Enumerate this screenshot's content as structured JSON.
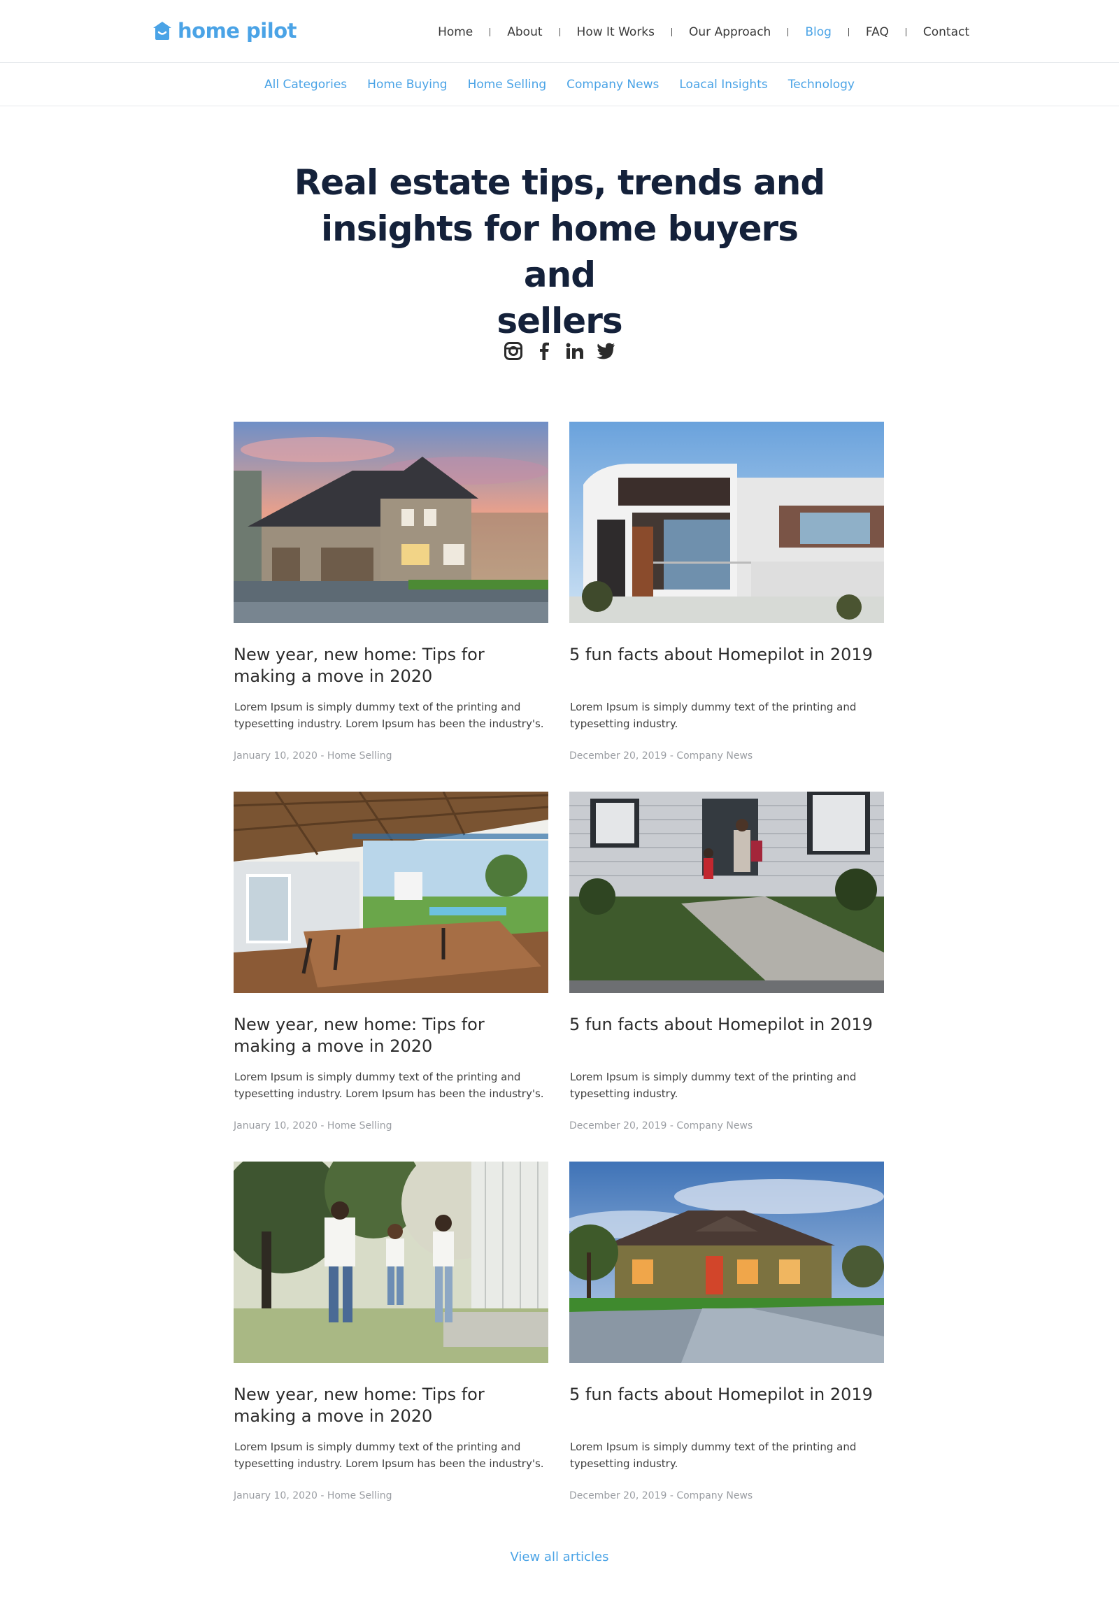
{
  "brand": {
    "name": "home pilot",
    "color": "#4aa3e6"
  },
  "main_nav": [
    {
      "label": "Home",
      "active": false
    },
    {
      "label": "About",
      "active": false
    },
    {
      "label": "How It Works",
      "active": false
    },
    {
      "label": "Our Approach",
      "active": false
    },
    {
      "label": "Blog",
      "active": true
    },
    {
      "label": "FAQ",
      "active": false
    },
    {
      "label": "Contact",
      "active": false
    }
  ],
  "categories": [
    "All Categories",
    "Home Buying",
    "Home Selling",
    "Company News",
    "Loacal Insights",
    "Technology"
  ],
  "hero": {
    "title_line1": "Real estate tips, trends and",
    "title_line2": "insights for home buyers and",
    "title_line3": "sellers"
  },
  "social_icons": [
    "instagram-icon",
    "facebook-icon",
    "linkedin-icon",
    "twitter-icon"
  ],
  "articles": [
    {
      "image": "suburban house at sunset",
      "title": "New year, new home: Tips for making a move in 2020",
      "excerpt": "Lorem Ipsum is simply dummy text of the printing and typesetting industry. Lorem Ipsum has been the industry's.",
      "meta": "January 10, 2020 - Home Selling"
    },
    {
      "image": "modern white house with balconies",
      "title": "5 fun facts about Homepilot in 2019",
      "excerpt": "Lorem Ipsum is simply dummy text of the printing and typesetting industry.",
      "meta": "December 20, 2019 - Company News"
    },
    {
      "image": "covered patio with pool view",
      "title": "New year, new home: Tips for making a move in 2020",
      "excerpt": "Lorem Ipsum is simply dummy text of the printing and typesetting industry. Lorem Ipsum has been the industry's.",
      "meta": "January 10, 2020 - Home Selling"
    },
    {
      "image": "family walking to front door",
      "title": "5 fun facts about Homepilot in 2019",
      "excerpt": "Lorem Ipsum is simply dummy text of the printing and typesetting industry.",
      "meta": "December 20, 2019 - Company News"
    },
    {
      "image": "family playing in park",
      "title": "New year, new home: Tips for making a move in 2020",
      "excerpt": "Lorem Ipsum is simply dummy text of the printing and typesetting industry. Lorem Ipsum has been the industry's.",
      "meta": "January 10, 2020 - Home Selling"
    },
    {
      "image": "lit house at dusk",
      "title": "5 fun facts about Homepilot in 2019",
      "excerpt": "Lorem Ipsum is simply dummy text of the printing and typesetting industry.",
      "meta": "December 20, 2019 - Company News"
    }
  ],
  "view_all_label": "View all articles"
}
